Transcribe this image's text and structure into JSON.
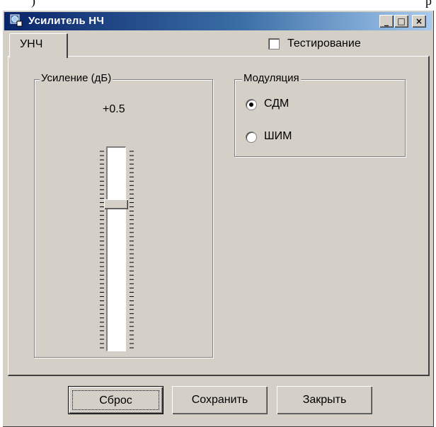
{
  "window": {
    "title": "Усилитель НЧ",
    "controls": {
      "minimize": "_",
      "maximize": "□",
      "close": "×"
    }
  },
  "tabs": [
    {
      "label": "УНЧ",
      "active": true
    }
  ],
  "testing_checkbox": {
    "label": "Тестирование",
    "checked": false
  },
  "gain_group": {
    "title": "Усиление (дБ)",
    "value": "+0.5",
    "slider_level": 0.27
  },
  "modulation_group": {
    "title": "Модуляция",
    "options": [
      {
        "label": "СДМ",
        "selected": true
      },
      {
        "label": "ШИМ",
        "selected": false
      }
    ]
  },
  "buttons": {
    "reset": "Сброс",
    "save": "Сохранить",
    "close": "Закрыть"
  }
}
